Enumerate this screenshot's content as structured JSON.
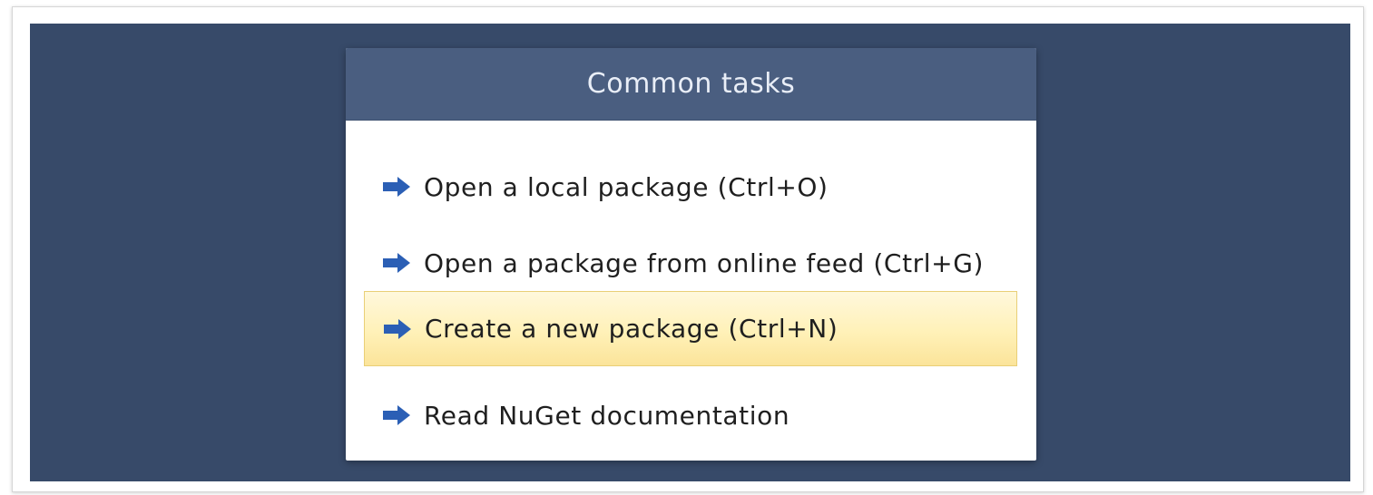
{
  "panel": {
    "title": "Common tasks",
    "items": [
      {
        "label": "Open a local package (Ctrl+O)",
        "icon": "arrow-right-icon",
        "highlighted": false
      },
      {
        "label": "Open a package from online feed (Ctrl+G)",
        "icon": "arrow-right-icon",
        "highlighted": false
      },
      {
        "label": "Create a new package (Ctrl+N)",
        "icon": "arrow-right-icon",
        "highlighted": true
      },
      {
        "label": "Read NuGet documentation",
        "icon": "arrow-right-icon",
        "highlighted": false
      }
    ]
  },
  "colors": {
    "backdrop": "#374a69",
    "header": "#4a5e80",
    "arrow": "#2b5fb5",
    "highlight": "#fff1b8"
  }
}
